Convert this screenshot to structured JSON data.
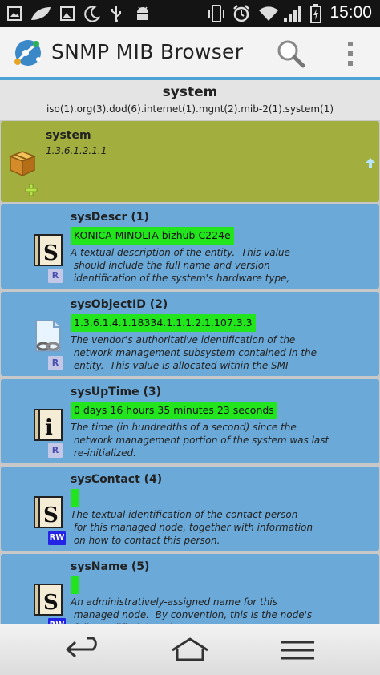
{
  "app": {
    "title": "SNMP MIB Browser",
    "accent": "#4fa2d6"
  },
  "status_bar": {
    "time": "15:00",
    "icons": [
      "image-icon",
      "leaf-icon",
      "picture-icon",
      "moon-icon",
      "usb-icon",
      "android-icon",
      "vibrate-icon",
      "alarm-icon",
      "wifi-icon",
      "signal-icon",
      "battery-charging-icon"
    ]
  },
  "header": {
    "title": "system",
    "path": "iso(1).org(3).dod(6).internet(1).mgnt(2).mib-2(1).system(1)"
  },
  "node": {
    "name": "system",
    "oid": "1.3.6.1.2.1.1",
    "color": "#a2ae3d"
  },
  "leaves": [
    {
      "name": "sysDescr (1)",
      "value": "KONICA MINOLTA bizhub C224e",
      "desc": "A textual description of the entity.  This value\n should include the full name and version\n identification of the system's hardware type,",
      "icon": "string-icon",
      "access": "R"
    },
    {
      "name": "sysObjectID (2)",
      "value": "1.3.6.1.4.1.18334.1.1.1.2.1.107.3.3",
      "desc": "The vendor's authoritative identification of the\n network management subsystem contained in the\n entity.  This value is allocated within the SMI",
      "icon": "oid-link-icon",
      "access": "R"
    },
    {
      "name": "sysUpTime (3)",
      "value": "0 days 16 hours 35 minutes 23 seconds",
      "desc": "The time (in hundredths of a second) since the\n network management portion of the system was last\n re-initialized.",
      "icon": "integer-icon",
      "access": "R"
    },
    {
      "name": "sysContact (4)",
      "value": "",
      "desc": "The textual identification of the contact person\n for this managed node, together with information\n on how to contact this person.",
      "icon": "string-icon",
      "access": "RW"
    },
    {
      "name": "sysName (5)",
      "value": "",
      "desc": "An administratively-assigned name for this\n managed node.  By convention, this is the node's\n fully-qualified domain name.",
      "icon": "string-icon",
      "access": "RW"
    }
  ],
  "colors": {
    "leaf_bg": "#6aa9d8",
    "value_bg": "#22e51e",
    "badge_rw": "#2424e6"
  }
}
